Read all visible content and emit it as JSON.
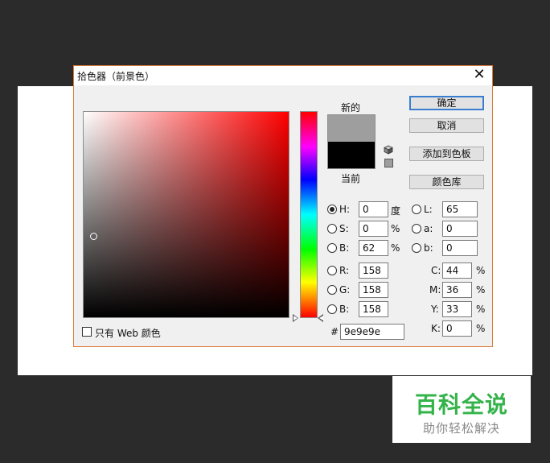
{
  "dialog": {
    "title": "拾色器（前景色）",
    "close_glyph": "✕",
    "new_label": "新的",
    "current_label": "当前",
    "new_color": "#9e9e9e",
    "current_color": "#000000",
    "accent_border": "#e07a3c"
  },
  "buttons": {
    "ok": "确定",
    "cancel": "取消",
    "add_to_swatches": "添加到色板",
    "color_libraries": "颜色库"
  },
  "hsb": [
    {
      "label": "H:",
      "value": "0",
      "unit": "度",
      "selected": true
    },
    {
      "label": "S:",
      "value": "0",
      "unit": "%",
      "selected": false
    },
    {
      "label": "B:",
      "value": "62",
      "unit": "%",
      "selected": false
    }
  ],
  "rgb": [
    {
      "label": "R:",
      "value": "158",
      "selected": false
    },
    {
      "label": "G:",
      "value": "158",
      "selected": false
    },
    {
      "label": "B:",
      "value": "158",
      "selected": false
    }
  ],
  "lab": [
    {
      "label": "L:",
      "value": "65",
      "selected": false
    },
    {
      "label": "a:",
      "value": "0",
      "selected": false
    },
    {
      "label": "b:",
      "value": "0",
      "selected": false
    }
  ],
  "cmyk": [
    {
      "label": "C:",
      "value": "44",
      "unit": "%"
    },
    {
      "label": "M:",
      "value": "36",
      "unit": "%"
    },
    {
      "label": "Y:",
      "value": "33",
      "unit": "%"
    },
    {
      "label": "K:",
      "value": "0",
      "unit": "%"
    }
  ],
  "hex": {
    "label": "#",
    "value": "9e9e9e"
  },
  "web_only": {
    "label": "只有 Web 颜色",
    "checked": false
  },
  "icons": {
    "cube": "cube-icon",
    "websafe": "websafe-swatch-icon"
  },
  "watermark": {
    "brand": "百科全说",
    "slogan": "助你轻松解决",
    "brand_color": "#33b34a"
  }
}
